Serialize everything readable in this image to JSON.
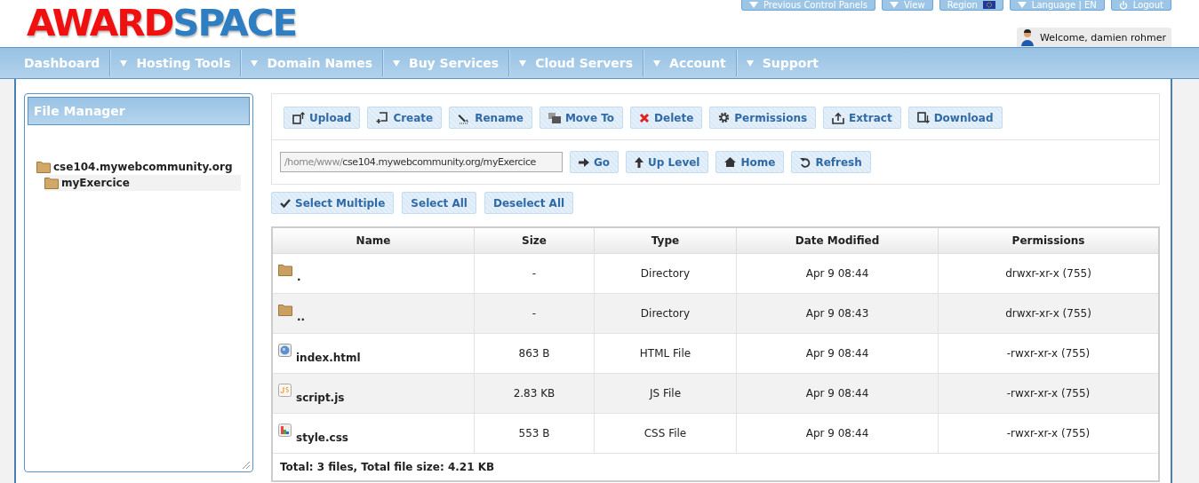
{
  "logo": {
    "part_1": "AWARD",
    "part_2": "SPACE"
  },
  "top_buttons": [
    {
      "label": "Previous Control Panels",
      "kind": "menu"
    },
    {
      "label": "View",
      "kind": "menu"
    },
    {
      "label": "Region",
      "kind": "region"
    },
    {
      "label": "Language | EN",
      "kind": "menu"
    },
    {
      "label": "Logout",
      "kind": "logout"
    }
  ],
  "welcome": "Welcome, damien rohmer",
  "nav": [
    {
      "label": "Dashboard",
      "dropdown": false
    },
    {
      "label": "Hosting Tools",
      "dropdown": true
    },
    {
      "label": "Domain Names",
      "dropdown": true
    },
    {
      "label": "Buy Services",
      "dropdown": true
    },
    {
      "label": "Cloud Servers",
      "dropdown": true
    },
    {
      "label": "Account",
      "dropdown": true
    },
    {
      "label": "Support",
      "dropdown": true
    }
  ],
  "sidebar": {
    "title": "File Manager",
    "tree": [
      {
        "label": "cse104.mywebcommunity.org",
        "selected": false,
        "children": [
          {
            "label": "myExercice",
            "selected": true
          }
        ]
      }
    ]
  },
  "toolbar": [
    "Upload",
    "Create",
    "Rename",
    "Move To",
    "Delete",
    "Permissions",
    "Extract",
    "Download"
  ],
  "path": {
    "prefix": "/home/www/",
    "value": "cse104.mywebcommunity.org/myExercice"
  },
  "nav_buttons": [
    "Go",
    "Up Level",
    "Home",
    "Refresh"
  ],
  "select_buttons": [
    "Select Multiple",
    "Select All",
    "Deselect All"
  ],
  "table": {
    "columns": [
      "Name",
      "Size",
      "Type",
      "Date Modified",
      "Permissions"
    ],
    "rows": [
      {
        "kind": "folder",
        "cells": [
          ".",
          "-",
          "Directory",
          "Apr 9 08:44",
          "drwxr-xr-x (755)"
        ]
      },
      {
        "kind": "folder",
        "cells": [
          "..",
          "-",
          "Directory",
          "Apr 9 08:43",
          "drwxr-xr-x (755)"
        ]
      },
      {
        "kind": "web",
        "cells": [
          "index.html",
          "863 B",
          "HTML File",
          "Apr 9 08:44",
          "-rwxr-xr-x (755)"
        ]
      },
      {
        "kind": "script",
        "cells": [
          "script.js",
          "2.83 KB",
          "JS File",
          "Apr 9 08:44",
          "-rwxr-xr-x (755)"
        ]
      },
      {
        "kind": "style",
        "cells": [
          "style.css",
          "553 B",
          "CSS File",
          "Apr 9 08:44",
          "-rwxr-xr-x (755)"
        ]
      }
    ],
    "footer": "Total: 3 files, Total file size: 4.21 KB"
  }
}
